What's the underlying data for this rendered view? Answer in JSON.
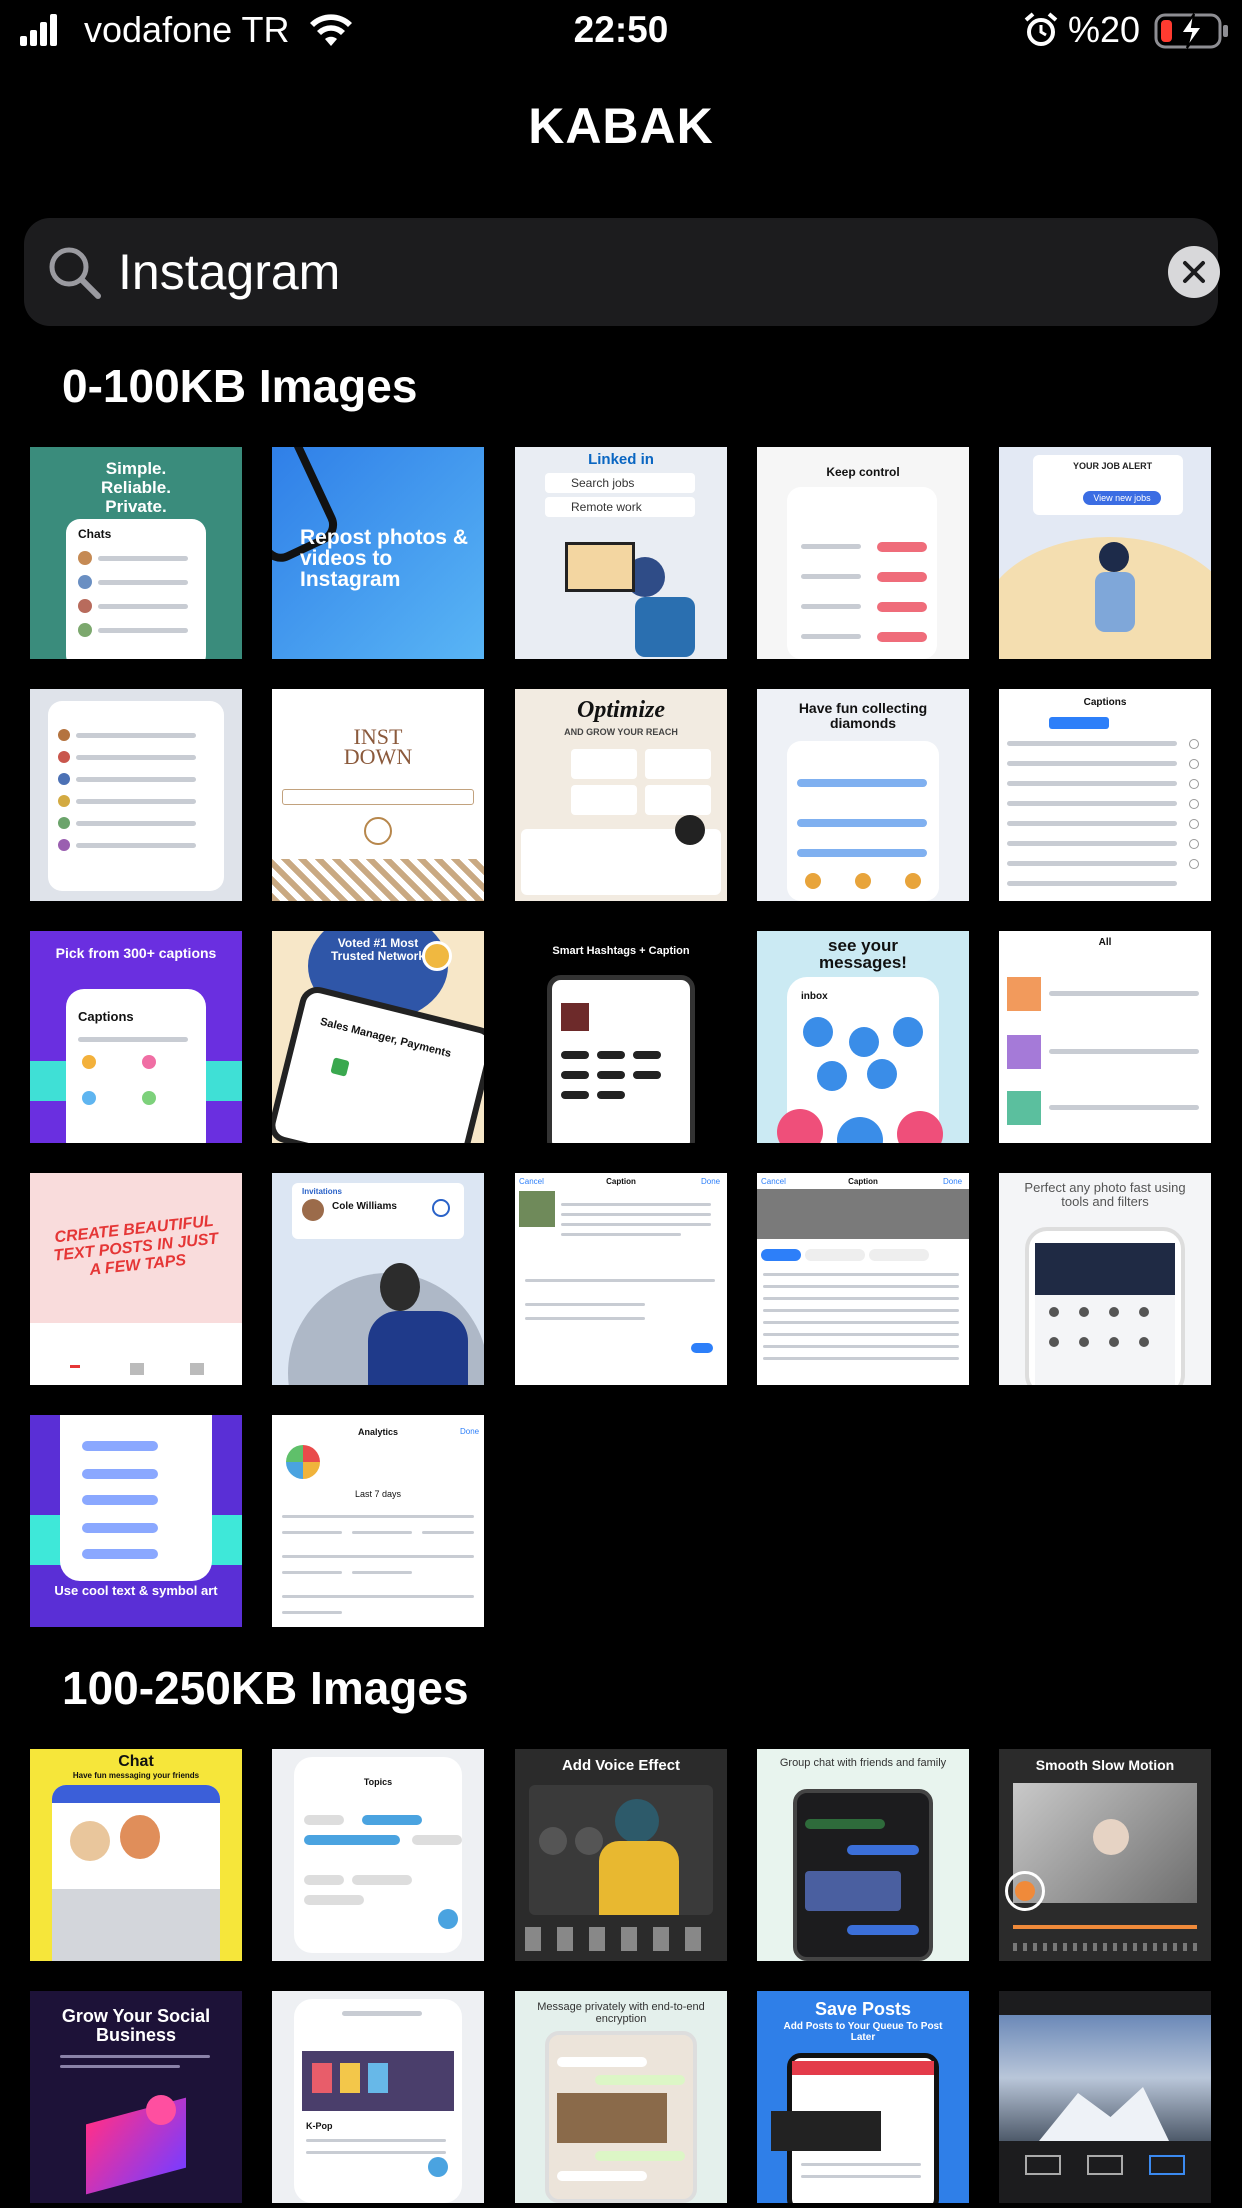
{
  "status_bar": {
    "carrier": "vodafone TR",
    "time": "22:50",
    "battery_percent": "%20",
    "battery_level": 0.2,
    "battery_color": "#ff3b30",
    "icons": [
      "signal-icon",
      "wifi-icon",
      "alarm-icon",
      "battery-icon"
    ]
  },
  "app": {
    "title": "KABAK"
  },
  "search": {
    "value": "Instagram",
    "icon": "search-icon",
    "clear_icon": "clear-icon"
  },
  "sections": [
    {
      "title": "0-100KB Images",
      "tiles": [
        {
          "caption": "Simple.\nReliable.\nPrivate.",
          "subtitle": "Chats"
        },
        {
          "caption": "Repost photos & videos to Instagram"
        },
        {
          "caption": "Linked in",
          "items": [
            "Search jobs",
            "Remote work"
          ]
        },
        {
          "caption": "Keep control"
        },
        {
          "caption": "YOUR JOB ALERT",
          "button": "View new jobs"
        },
        {
          "caption": ""
        },
        {
          "caption": "INST DOWN"
        },
        {
          "caption": "Optimize",
          "subtitle": "AND GROW YOUR REACH"
        },
        {
          "caption": "Have fun collecting diamonds"
        },
        {
          "caption": "Captions"
        },
        {
          "caption": "Pick from 300+ captions",
          "subtitle": "Captions"
        },
        {
          "caption": "Voted #1 Most Trusted Network",
          "subtitle": "Sales Manager, Payments"
        },
        {
          "caption": "Smart Hashtags + Caption"
        },
        {
          "caption": "see your messages!",
          "subtitle": "inbox"
        },
        {
          "caption": "All"
        },
        {
          "caption": "CREATE BEAUTIFUL TEXT POSTS IN JUST A FEW TAPS"
        },
        {
          "caption": "Invitations",
          "subtitle": "Cole Williams"
        },
        {
          "caption": "Caption",
          "left": "Cancel",
          "right": "Done"
        },
        {
          "caption": "Caption",
          "left": "Cancel",
          "right": "Done"
        },
        {
          "caption": "Perfect any photo fast using tools and filters"
        },
        {
          "caption": "Use cool text & symbol art"
        },
        {
          "caption": "Analytics",
          "subtitle": "Last 7 days",
          "right": "Done"
        }
      ]
    },
    {
      "title": "100-250KB Images",
      "tiles": [
        {
          "caption": "Chat",
          "subtitle": "Have fun messaging your friends"
        },
        {
          "caption": "Topics"
        },
        {
          "caption": "Add Voice Effect"
        },
        {
          "caption": "Group chat with friends and family"
        },
        {
          "caption": "Smooth Slow Motion"
        },
        {
          "caption": "Grow Your Social Business"
        },
        {
          "caption": "K-Pop"
        },
        {
          "caption": "Message privately with end-to-end encryption"
        },
        {
          "caption": "Save Posts",
          "subtitle": "Add Posts to Your Queue To Post Later"
        },
        {
          "caption": ""
        }
      ]
    }
  ]
}
